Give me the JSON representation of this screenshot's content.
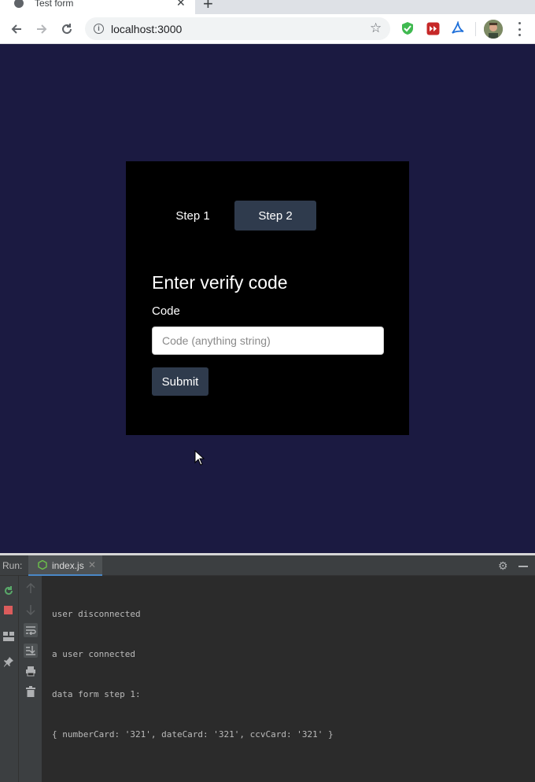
{
  "browser": {
    "tab_title": "Test form",
    "tab_close": "✕",
    "new_tab": "+",
    "url": "localhost:3000"
  },
  "form": {
    "steps": [
      {
        "label": "Step 1",
        "active": false
      },
      {
        "label": "Step 2",
        "active": true
      }
    ],
    "title": "Enter verify code",
    "code_label": "Code",
    "code_placeholder": "Code (anything string)",
    "code_value": "",
    "submit_label": "Submit"
  },
  "ide": {
    "run_label": "Run:",
    "file_tab": "index.js",
    "file_tab_close": "✕",
    "console_lines": [
      "user disconnected",
      "a user connected",
      "data form step 1:",
      "{ numberCard: '321', dateCard: '321', ccvCard: '321' }"
    ]
  },
  "colors": {
    "page_bg": "#1b1a41",
    "card_bg": "#000000",
    "active_step_bg": "#2f3b4d",
    "submit_bg": "#2f3b4d",
    "console_bg": "#2b2b2b"
  },
  "icons": [
    "back-arrow-icon",
    "forward-arrow-icon",
    "reload-icon",
    "info-icon",
    "star-icon",
    "shield-extension-icon",
    "media-extension-icon",
    "acrobat-extension-icon",
    "profile-avatar",
    "menu-dots-icon",
    "gear-icon",
    "minimize-icon",
    "rerun-icon",
    "stop-icon",
    "layout-icon",
    "pin-icon",
    "up-arrow-icon",
    "down-arrow-icon",
    "soft-wrap-icon",
    "scroll-to-end-icon",
    "print-icon",
    "trash-icon",
    "nodejs-icon"
  ]
}
